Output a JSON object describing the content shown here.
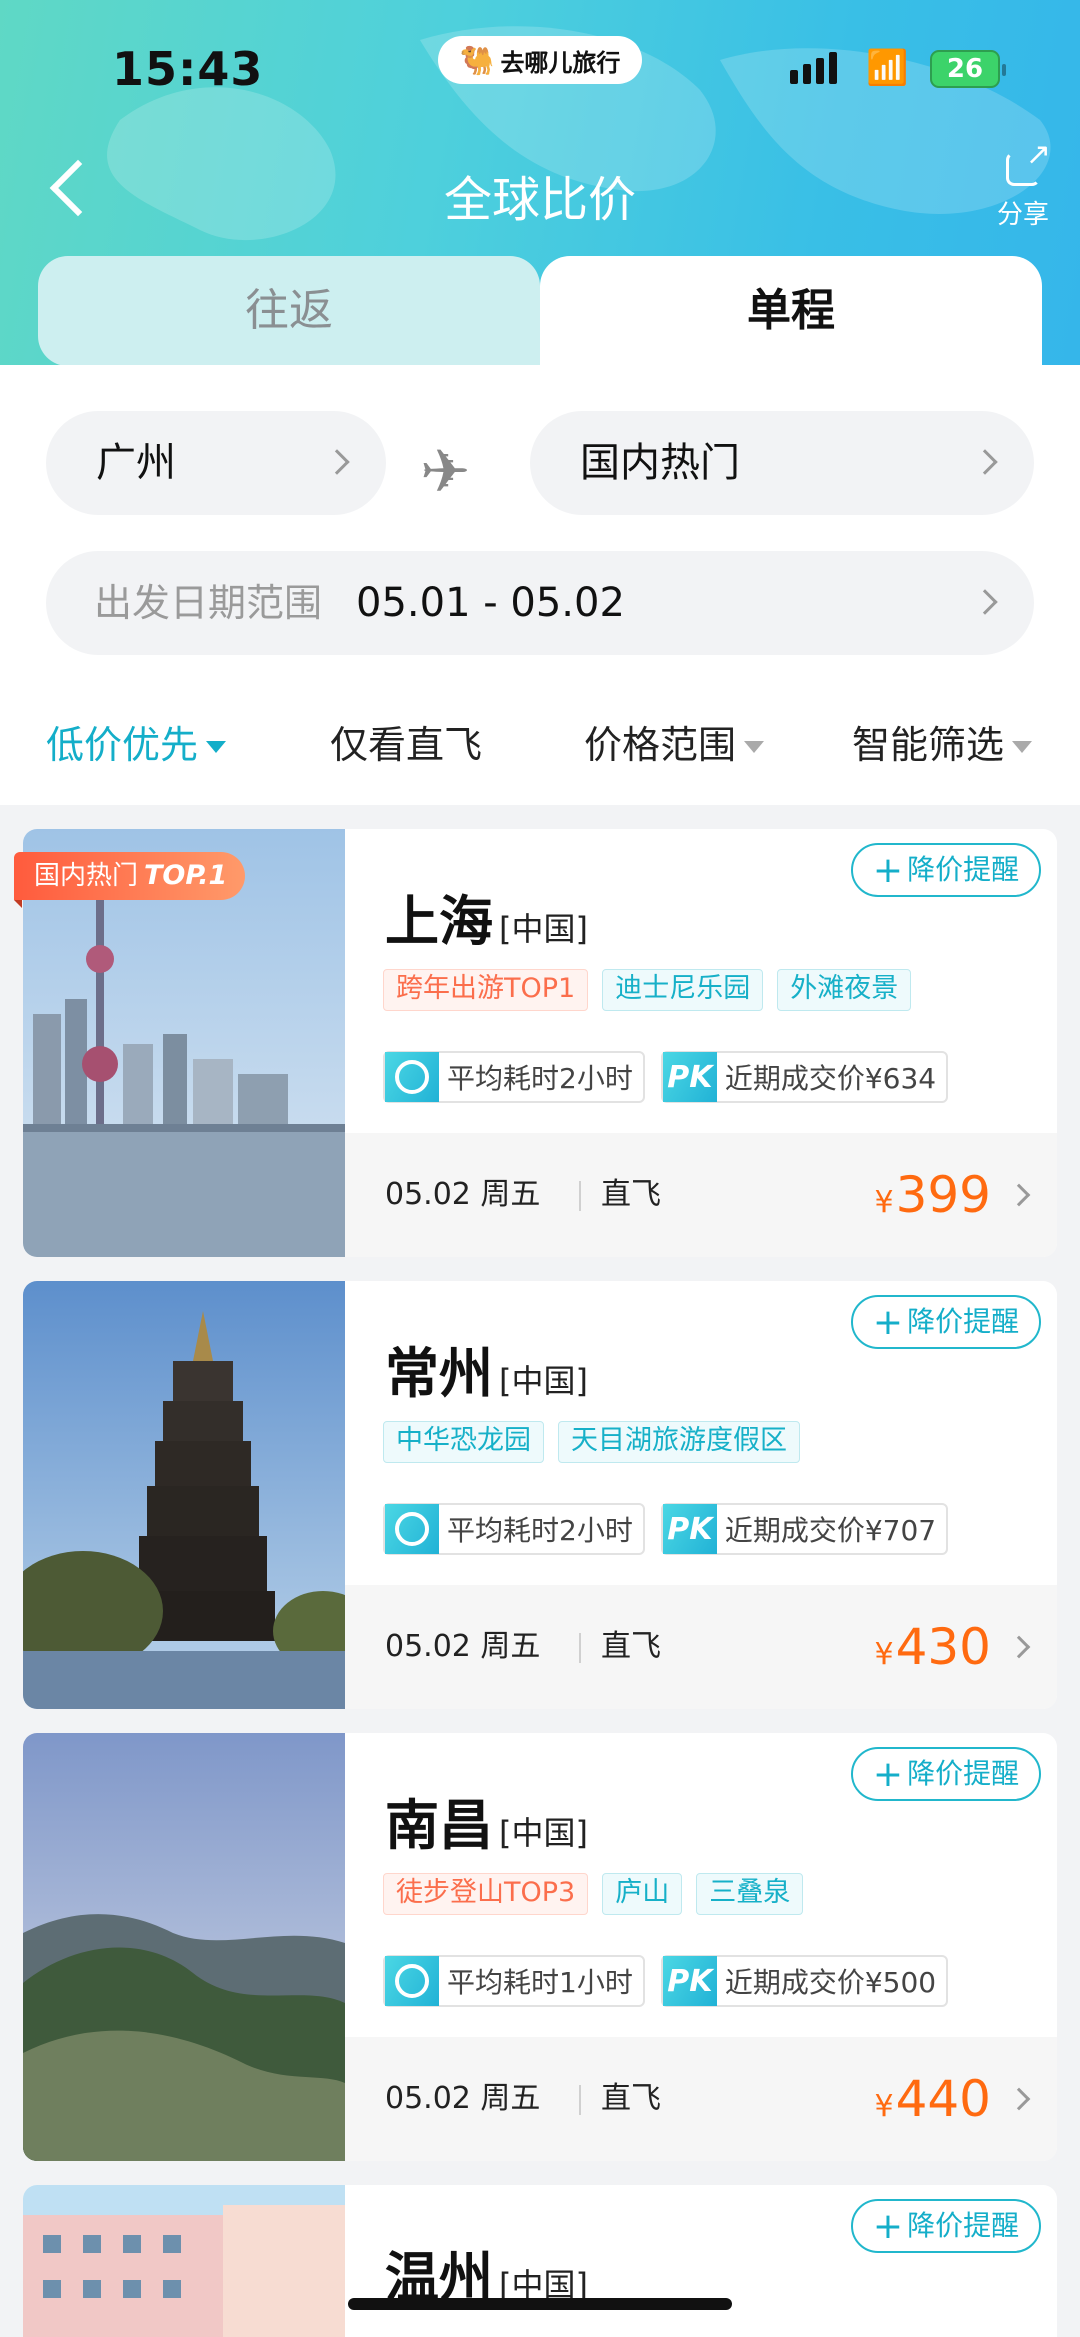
{
  "status_bar": {
    "time": "15:43",
    "brand": "去哪儿旅行",
    "battery": "26"
  },
  "header": {
    "title": "全球比价",
    "share_label": "分享"
  },
  "tabs": [
    {
      "label": "往返",
      "active": false
    },
    {
      "label": "单程",
      "active": true
    }
  ],
  "search": {
    "from": "广州",
    "to": "国内热门",
    "date_label": "出发日期范围",
    "date_value": "05.01 - 05.02"
  },
  "filters": [
    {
      "label": "低价优先",
      "active": true
    },
    {
      "label": "仅看直飞"
    },
    {
      "label": "价格范围"
    },
    {
      "label": "智能筛选"
    }
  ],
  "alert_label": "降价提醒",
  "top_badge": {
    "text": "国内热门",
    "rank": "TOP.1"
  },
  "results": [
    {
      "city": "上海",
      "country": "[中国]",
      "tags": [
        "跨年出游TOP1",
        "迪士尼乐园",
        "外滩夜景"
      ],
      "duration": "平均耗时2小时",
      "pk_label": "PK",
      "recent_price": "近期成交价¥634",
      "date": "05.02 周五",
      "direct": "直飞",
      "currency": "¥",
      "price": "399"
    },
    {
      "city": "常州",
      "country": "[中国]",
      "tags": [
        "中华恐龙园",
        "天目湖旅游度假区"
      ],
      "duration": "平均耗时2小时",
      "pk_label": "PK",
      "recent_price": "近期成交价¥707",
      "date": "05.02 周五",
      "direct": "直飞",
      "currency": "¥",
      "price": "430"
    },
    {
      "city": "南昌",
      "country": "[中国]",
      "tags": [
        "徒步登山TOP3",
        "庐山",
        "三叠泉"
      ],
      "duration": "平均耗时1小时",
      "pk_label": "PK",
      "recent_price": "近期成交价¥500",
      "date": "05.02 周五",
      "direct": "直飞",
      "currency": "¥",
      "price": "440"
    },
    {
      "city": "温州",
      "country": "[中国]"
    }
  ],
  "colors": {
    "accent": "#14aec9",
    "price": "#ff6a10",
    "hot_tag": "#fb6e4c"
  }
}
